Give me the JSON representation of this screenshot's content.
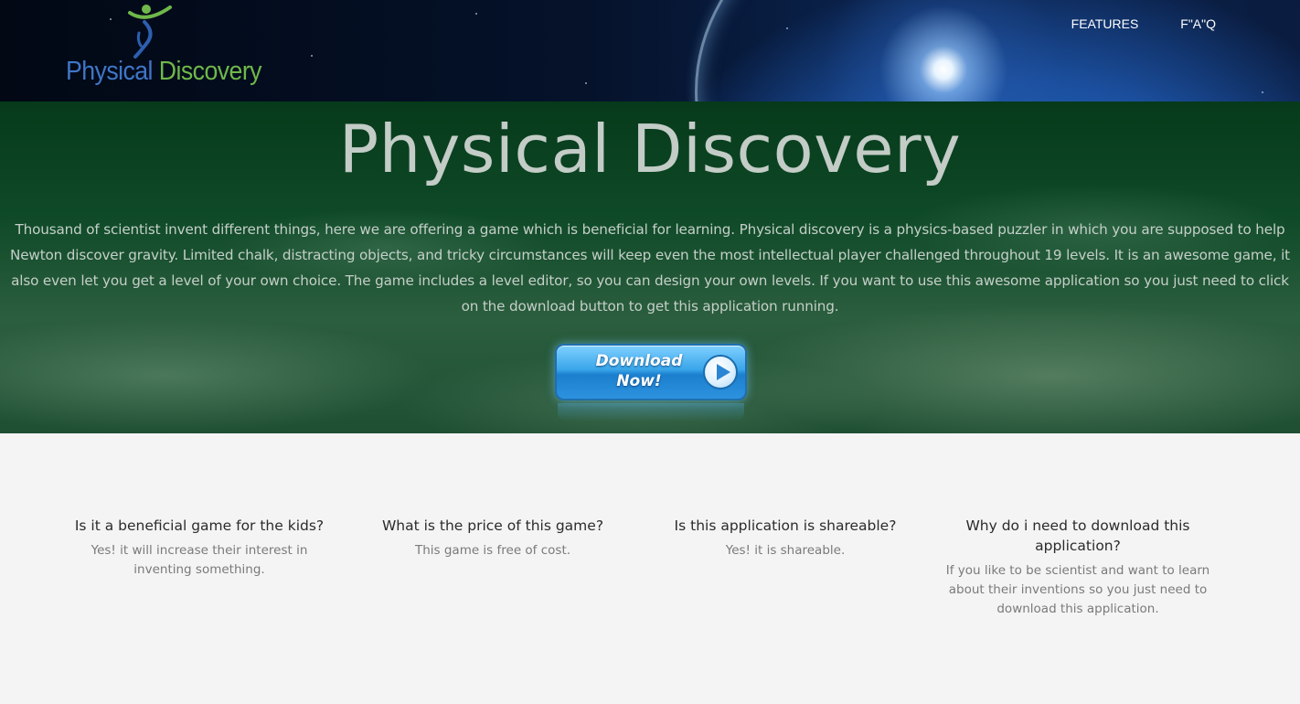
{
  "header": {
    "logo": {
      "word1": "Physical",
      "word2": "Discovery"
    },
    "nav": [
      {
        "label": "FEATURES"
      },
      {
        "label": "F\"A\"Q"
      }
    ]
  },
  "hero": {
    "title": "Physical Discovery",
    "description": "Thousand of scientist invent different things, here we are offering a game which is beneficial for learning. Physical discovery is a physics-based puzzler in which you are supposed to help Newton discover gravity. Limited chalk, distracting objects, and tricky circumstances will keep even the most intellectual player challenged throughout 19 levels. It is an awesome game, it also even let you get a level of your own choice. The game includes a level editor, so you can design your own levels. If you want to use this awesome application so you just need to click on the download button to get this application running.",
    "download_button": {
      "line1": "Download",
      "line2": "Now!"
    }
  },
  "faq": [
    {
      "question": "Is it a beneficial game for the kids?",
      "answer": "Yes! it will increase their interest in inventing something."
    },
    {
      "question": "What is the price of this game?",
      "answer": "This game is free of cost."
    },
    {
      "question": "Is this application is shareable?",
      "answer": "Yes! it is shareable."
    },
    {
      "question": "Why do i need to download this application?",
      "answer": "If you like to be scientist and want to learn about their inventions so you just need to download this application."
    }
  ],
  "colors": {
    "header_bg": "#05122a",
    "hero_overlay": "#0f4a28",
    "logo_blue": "#3f76c8",
    "logo_green": "#6fb84a",
    "page_bg": "#f4f4f4"
  }
}
